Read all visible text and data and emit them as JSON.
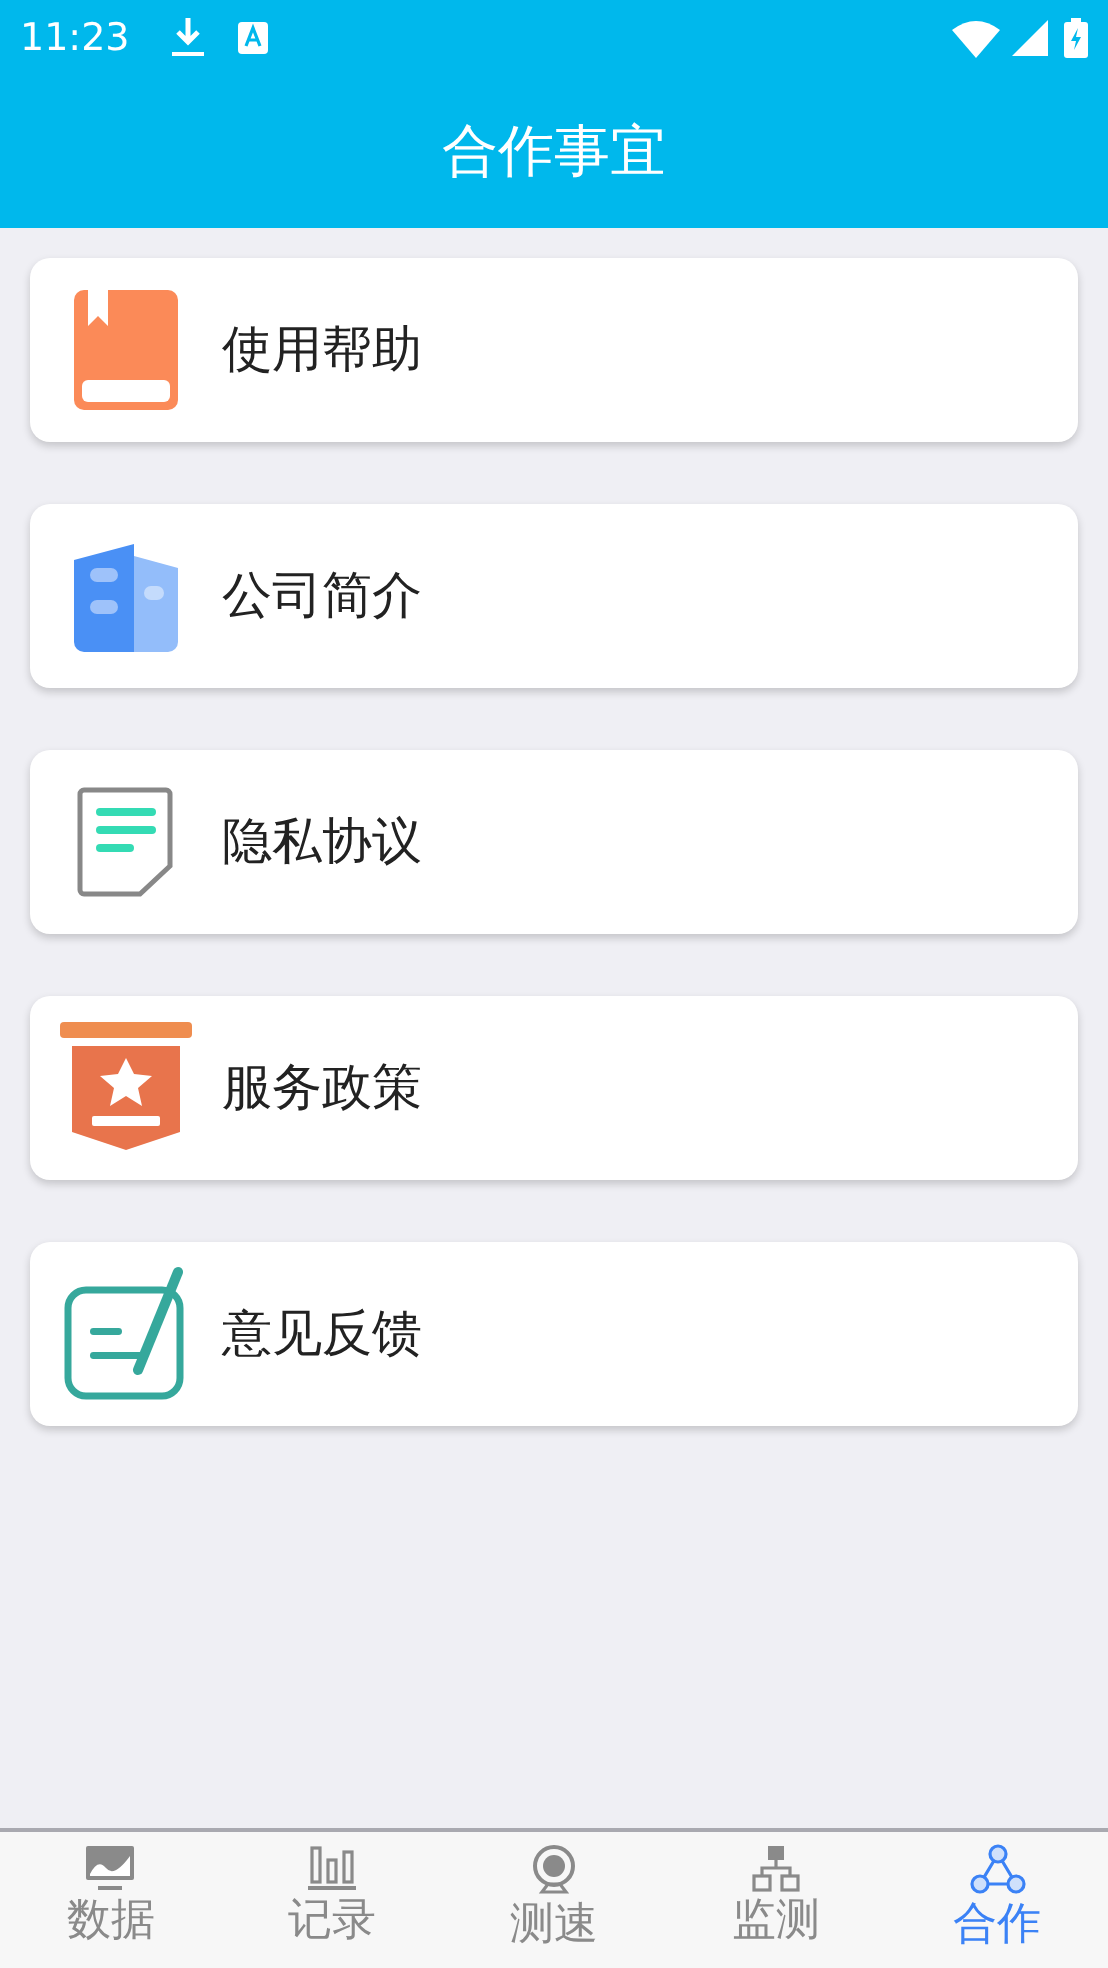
{
  "status_bar": {
    "time": "11:23"
  },
  "header": {
    "title": "合作事宜"
  },
  "items": [
    {
      "kind": "book",
      "label": "使用帮助"
    },
    {
      "kind": "building",
      "label": "公司简介"
    },
    {
      "kind": "document",
      "label": "隐私协议"
    },
    {
      "kind": "banner",
      "label": "服务政策"
    },
    {
      "kind": "feedback",
      "label": "意见反馈"
    }
  ],
  "tabs": [
    {
      "kind": "chart",
      "label": "数据",
      "selected": false
    },
    {
      "kind": "bars",
      "label": "记录",
      "selected": false
    },
    {
      "kind": "camera",
      "label": "测速",
      "selected": false
    },
    {
      "kind": "network",
      "label": "监测",
      "selected": false
    },
    {
      "kind": "circles",
      "label": "合作",
      "selected": true
    }
  ]
}
